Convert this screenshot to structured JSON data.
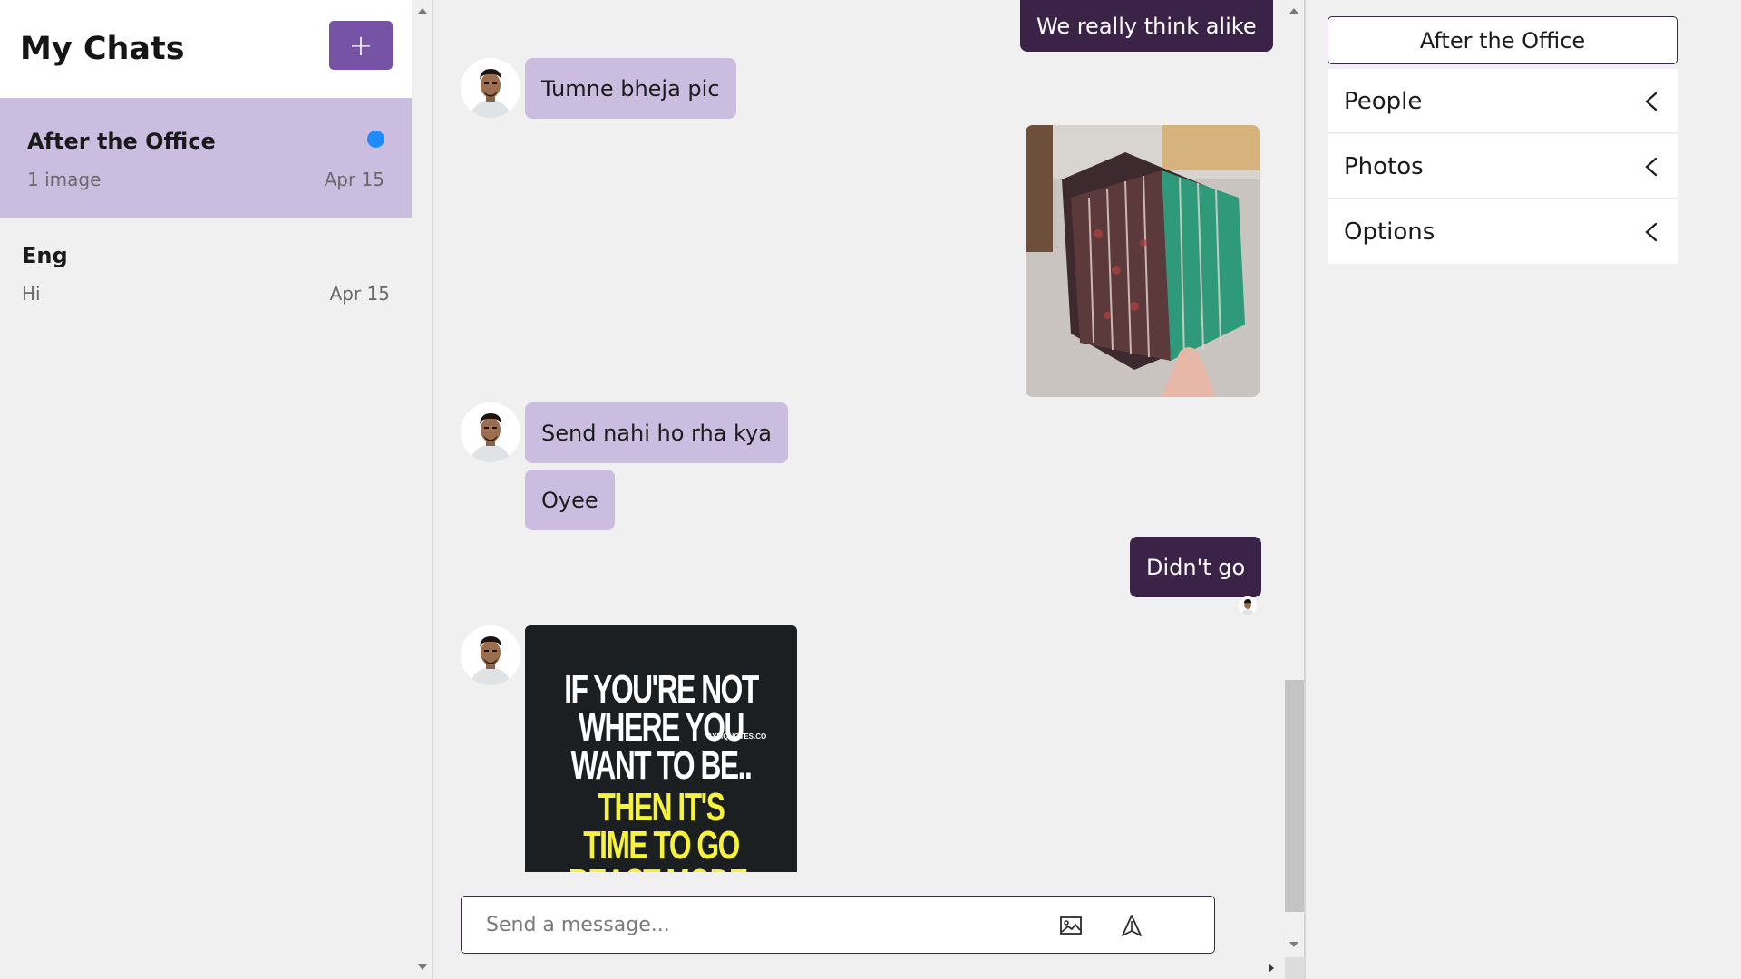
{
  "sidebar": {
    "title": "My Chats",
    "new_chat_label": "+",
    "chats": [
      {
        "name": "After the Office",
        "preview": "1 image",
        "date": "Apr 15",
        "unread": true
      },
      {
        "name": "Eng",
        "preview": "Hi",
        "date": "Apr 15",
        "unread": false
      }
    ]
  },
  "messages": {
    "m1": "We really think alike",
    "m2": "Tumne bheja pic",
    "m3": "Send nahi ho rha kya",
    "m4": "Oyee",
    "m5": "Didn't go"
  },
  "quote_image": {
    "line1": "IF YOU'RE NOT WHERE YOU WANT TO BE..",
    "site": "GYMQUOTES.CO",
    "line2": "THEN IT'S TIME TO GO BEAST MODE."
  },
  "composer": {
    "placeholder": "Send a message..."
  },
  "details": {
    "group_name": "After the Office",
    "sections": [
      "People",
      "Photos",
      "Options"
    ]
  },
  "colors": {
    "accent": "#7653a4",
    "incoming_bubble": "#cbbddf",
    "outgoing_bubble": "#3a2347",
    "unread_dot": "#1e8dfb"
  }
}
